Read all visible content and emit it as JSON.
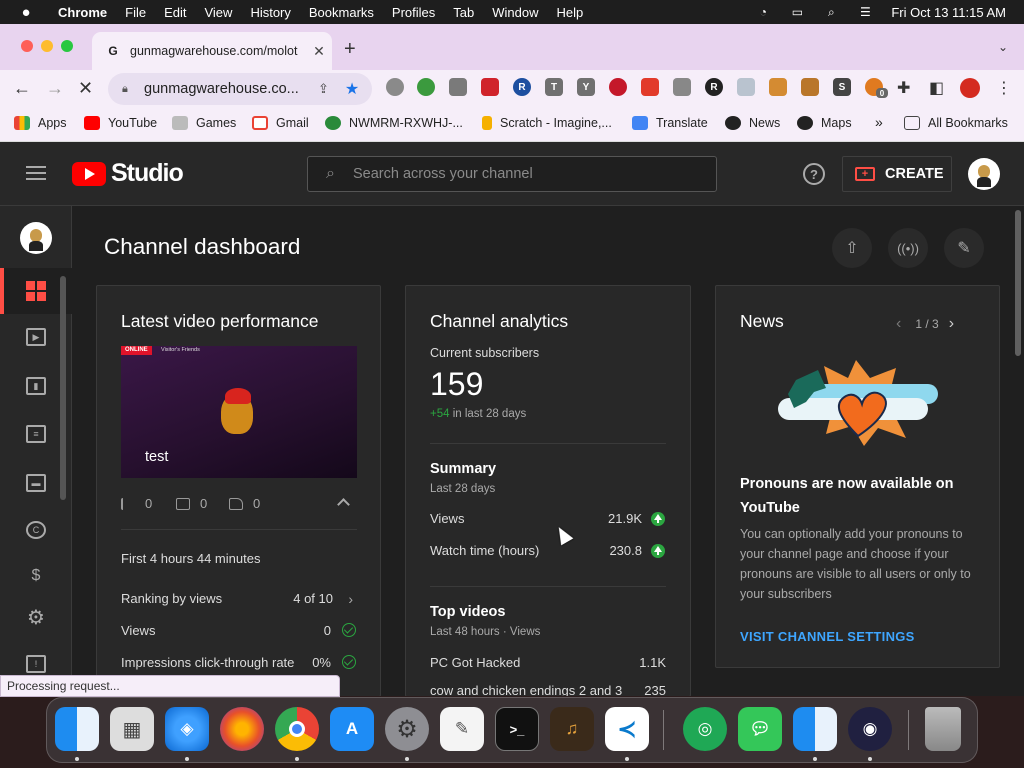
{
  "menubar": {
    "app": "Chrome",
    "items": [
      "File",
      "Edit",
      "View",
      "History",
      "Bookmarks",
      "Profiles",
      "Tab",
      "Window",
      "Help"
    ],
    "clock": "Fri Oct 13  11:15 AM"
  },
  "browser": {
    "tab_title": "gunmagwarehouse.com/molot",
    "url": "gunmagwarehouse.co...",
    "extension_badge": "0",
    "bookmarks": [
      "Apps",
      "YouTube",
      "Games",
      "Gmail",
      "NWMRM-RXWHJ-...",
      "Scratch - Imagine,...",
      "Translate",
      "News",
      "Maps"
    ],
    "more_bookmarks": "»",
    "all_bookmarks": "All Bookmarks",
    "status": "Processing request..."
  },
  "studio": {
    "logo_text": "Studio",
    "search_placeholder": "Search across your channel",
    "create_label": "CREATE",
    "page_title": "Channel dashboard",
    "latest_video": {
      "heading": "Latest video performance",
      "video_title": "test",
      "thumb_badge": "ONLINE",
      "thumb_caption": "Visitor's Friends",
      "views": "0",
      "comments": "0",
      "likes": "0",
      "time_since": "First 4 hours 44 minutes",
      "rows": [
        {
          "label": "Ranking by views",
          "value": "4 of 10"
        },
        {
          "label": "Views",
          "value": "0"
        },
        {
          "label": "Impressions click-through rate",
          "value": "0%"
        }
      ]
    },
    "analytics": {
      "heading": "Channel analytics",
      "subs_label": "Current subscribers",
      "subs_count": "159",
      "subs_delta": "+54",
      "subs_delta_suffix": " in last 28 days",
      "summary_heading": "Summary",
      "summary_period": "Last 28 days",
      "summary_rows": [
        {
          "label": "Views",
          "value": "21.9K"
        },
        {
          "label": "Watch time (hours)",
          "value": "230.8"
        }
      ],
      "top_heading": "Top videos",
      "top_period": "Last 48 hours · Views",
      "top_videos": [
        {
          "title": "PC Got Hacked",
          "views": "1.1K"
        },
        {
          "title": "cow and chicken endings 2 and 3",
          "views": "235"
        }
      ]
    },
    "news": {
      "heading": "News",
      "pager": "1 / 3",
      "title": "Pronouns are now available on YouTube",
      "body": "You can optionally add your pronouns to your channel page and choose if your pronouns are visible to all users or only to your subscribers",
      "link": "VISIT CHANNEL SETTINGS"
    }
  },
  "colors": {
    "accent_red": "#ff4e45",
    "positive_green": "#2ba640",
    "link_blue": "#3ea6ff"
  }
}
